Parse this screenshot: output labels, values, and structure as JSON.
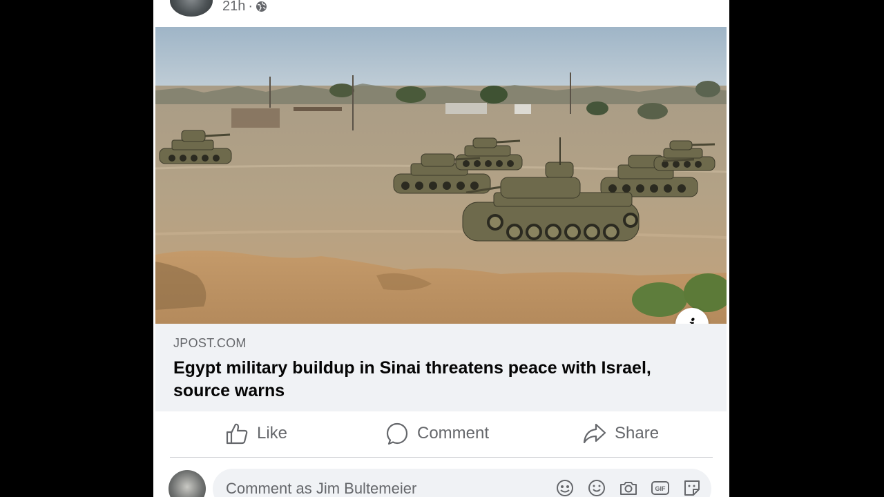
{
  "post": {
    "timestamp": "21h",
    "separator": "·",
    "privacy_icon": "globe-icon"
  },
  "link": {
    "domain": "JPOST.COM",
    "headline": "Egypt military buildup in Sinai threatens peace with Israel, source warns",
    "info_label": "i"
  },
  "actions": {
    "like": "Like",
    "comment": "Comment",
    "share": "Share"
  },
  "comment_box": {
    "placeholder": "Comment as Jim Bultemeier",
    "icons": [
      "avatar-sticker-icon",
      "emoji-icon",
      "camera-icon",
      "gif-icon",
      "sticker-icon"
    ]
  },
  "colors": {
    "background": "#000000",
    "card": "#ffffff",
    "secondary_text": "#65676b",
    "link_block": "#f0f2f5"
  }
}
